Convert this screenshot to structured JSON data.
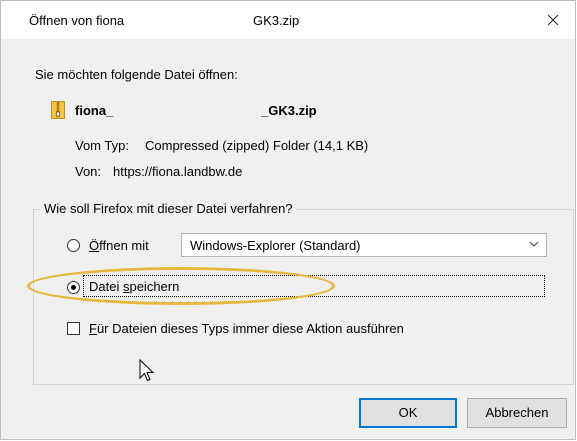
{
  "window": {
    "title_start": "Öffnen von fiona",
    "title_end": "GK3.zip",
    "close_icon": "close-icon"
  },
  "prompt": "Sie möchten folgende Datei öffnen:",
  "file": {
    "icon": "zip-folder-icon",
    "name_start": "fiona_",
    "name_end": "_GK3.zip",
    "type_label": "Vom Typ:",
    "type_value": "Compressed (zipped) Folder (14,1 KB)",
    "from_label": "Von:",
    "from_value": "https://fiona.landbw.de"
  },
  "action_group": {
    "legend": "Wie soll Firefox mit dieser Datei verfahren?",
    "open_with": {
      "label_mnemonic": "Ö",
      "label_rest": "ffnen mit",
      "selected": false,
      "app_select_value": "Windows-Explorer (Standard)"
    },
    "save_file": {
      "label_start": "Datei ",
      "label_mnemonic": "s",
      "label_rest": "peichern",
      "selected": true
    },
    "always_checkbox": {
      "label_mnemonic": "F",
      "label_rest": "ür Dateien dieses Typs immer diese Aktion ausführen",
      "checked": false
    }
  },
  "buttons": {
    "ok": "OK",
    "cancel": "Abbrechen"
  },
  "colors": {
    "highlight_ellipse": "#e8b73e",
    "default_button_border": "#0078d7"
  }
}
